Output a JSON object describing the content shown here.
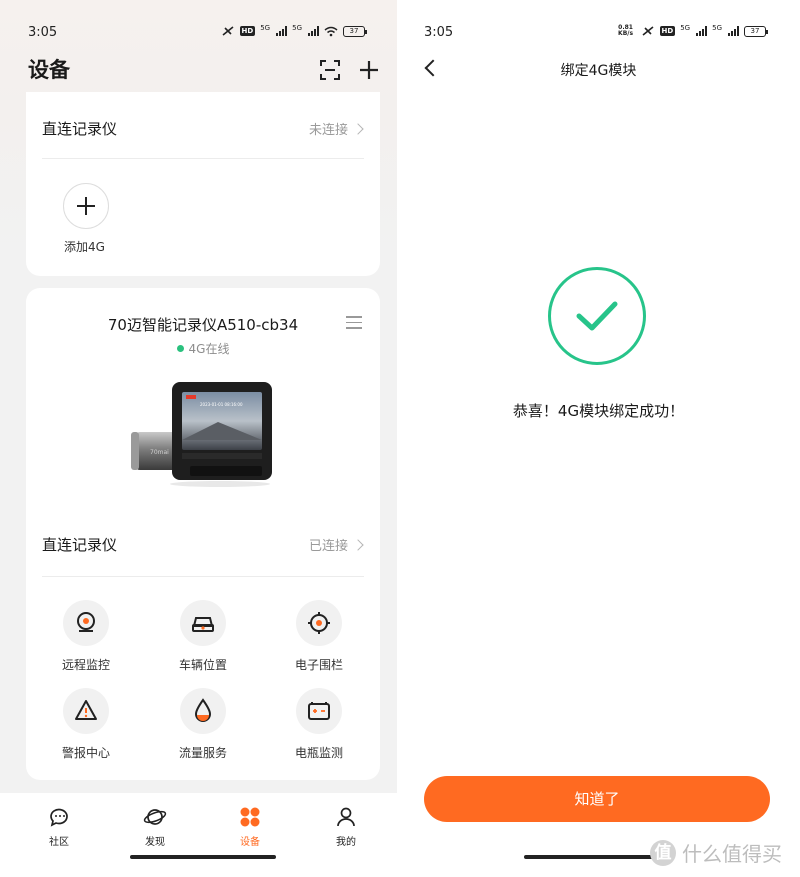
{
  "left": {
    "status": {
      "time": "3:05",
      "hd": "HD",
      "net1": "5G",
      "net2": "5G",
      "battery": "37"
    },
    "title": "设备",
    "direct_card": {
      "title": "直连记录仪",
      "status": "未连接",
      "add_label": "添加4G"
    },
    "device_card": {
      "name": "70迈智能记录仪A510-cb34",
      "online": "4G在线",
      "screen_text": "2023-01-01 08:16:00",
      "brand": "70mai",
      "direct_title": "直连记录仪",
      "direct_status": "已连接",
      "features": [
        {
          "label": "远程监控",
          "icon": "remote-monitor-icon"
        },
        {
          "label": "车辆位置",
          "icon": "car-location-icon"
        },
        {
          "label": "电子围栏",
          "icon": "geofence-icon"
        },
        {
          "label": "警报中心",
          "icon": "alert-icon"
        },
        {
          "label": "流量服务",
          "icon": "data-drop-icon"
        },
        {
          "label": "电瓶监测",
          "icon": "battery-monitor-icon"
        }
      ]
    },
    "nav": [
      {
        "label": "社区",
        "icon": "chat-bubble-icon"
      },
      {
        "label": "发现",
        "icon": "planet-icon"
      },
      {
        "label": "设备",
        "icon": "device-grid-icon",
        "active": true
      },
      {
        "label": "我的",
        "icon": "person-icon"
      }
    ]
  },
  "right": {
    "status": {
      "time": "3:05",
      "speed": "0.81 KB/s",
      "hd": "HD",
      "net1": "5G",
      "net2": "5G",
      "battery": "37"
    },
    "title": "绑定4G模块",
    "message": "恭喜！4G模块绑定成功！",
    "button": "知道了"
  },
  "watermark": {
    "logo": "值",
    "text": "什么值得买"
  },
  "colors": {
    "accent": "#ff6a21",
    "success": "#27c48a",
    "online": "#2ac17e",
    "muted": "#9a9a9a"
  }
}
